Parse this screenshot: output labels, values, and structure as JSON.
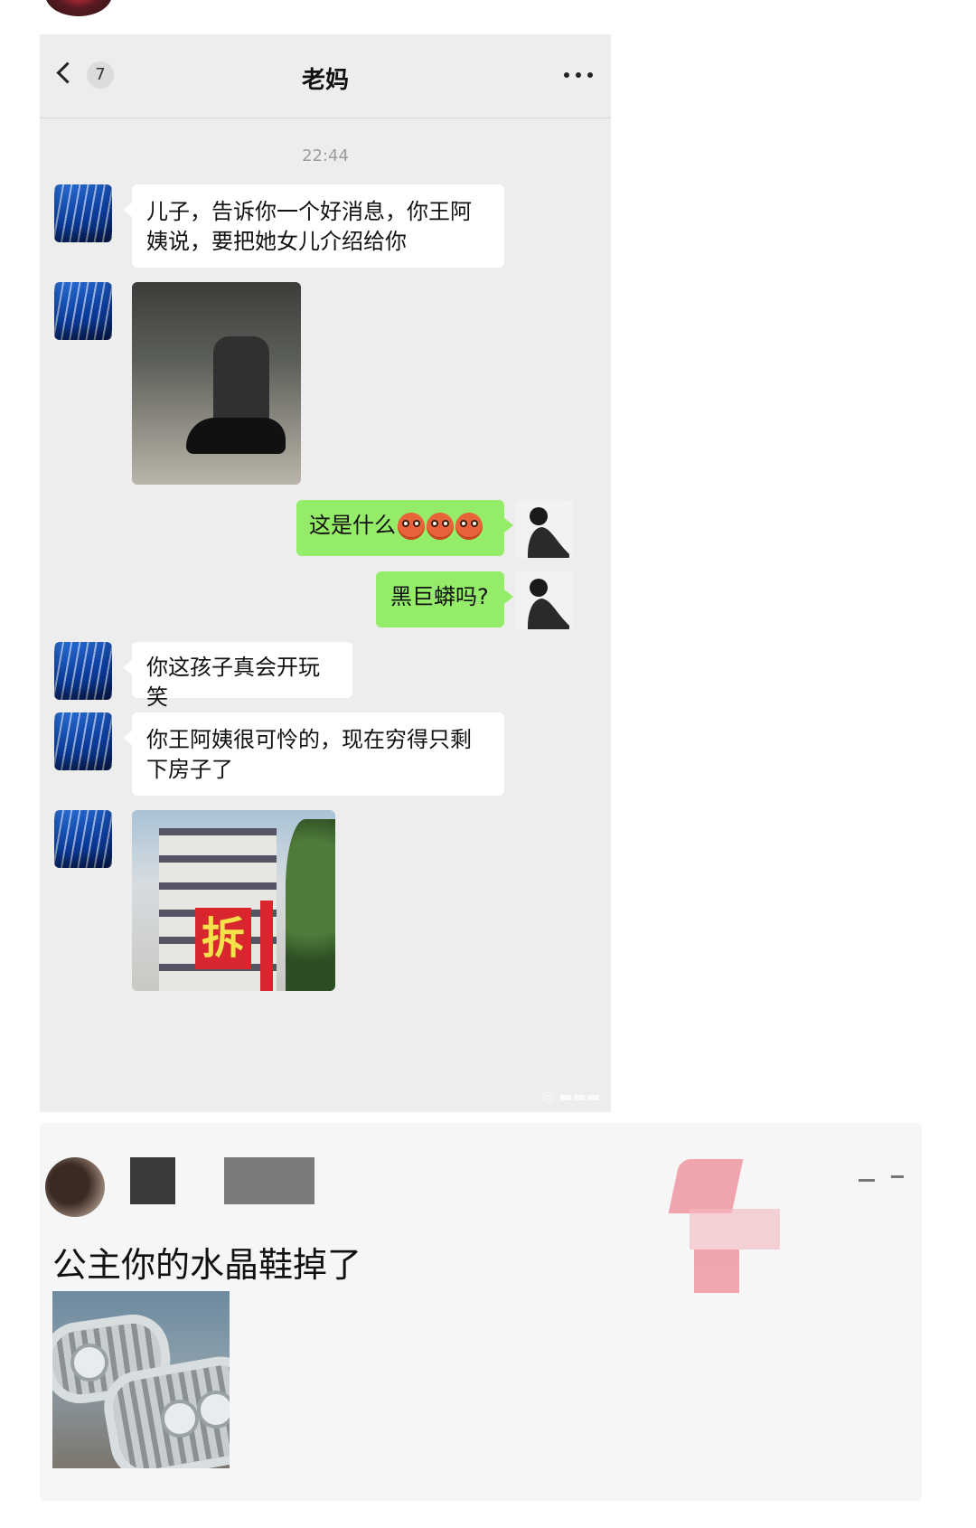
{
  "chat": {
    "nav": {
      "unread_count": "7",
      "title": "老妈"
    },
    "timestamp": "22:44",
    "messages": [
      {
        "from": "mom",
        "type": "text",
        "text": "儿子，告诉你一个好消息，你王阿姨说，要把她女儿介绍给你"
      },
      {
        "from": "mom",
        "type": "image",
        "image": "shoe-photo"
      },
      {
        "from": "me",
        "type": "text",
        "text": "这是什么",
        "emoji": [
          "angry-emoji",
          "angry-emoji",
          "angry-emoji"
        ]
      },
      {
        "from": "me",
        "type": "text",
        "text": "黑巨蟒吗?"
      },
      {
        "from": "mom",
        "type": "text",
        "text": "你这孩子真会开玩笑"
      },
      {
        "from": "mom",
        "type": "text",
        "text": "你王阿姨很可怜的，现在穷得只剩下房子了"
      },
      {
        "from": "mom",
        "type": "image",
        "image": "demolition-building-photo",
        "sign_text": "拆"
      }
    ]
  },
  "comment": {
    "text": "公主你的水晶鞋掉了",
    "image": "crystal-tank-tracks-photo"
  },
  "colors": {
    "chat_background": "#ededed",
    "my_bubble": "#95ec69",
    "their_bubble": "#ffffff",
    "sign_red": "#d8262e"
  }
}
